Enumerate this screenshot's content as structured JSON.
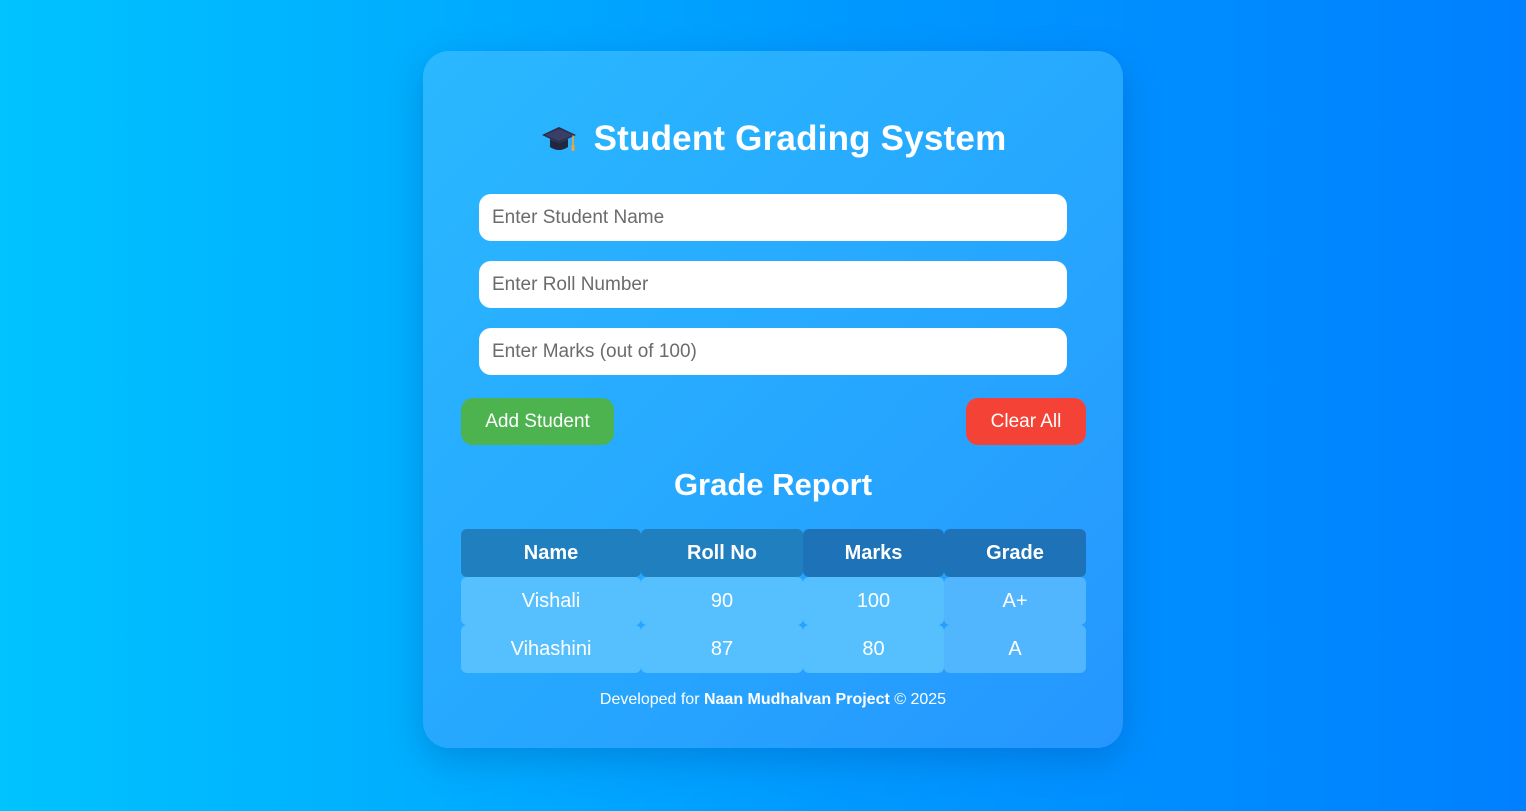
{
  "header": {
    "icon": "graduation-cap-icon",
    "title": "Student Grading System"
  },
  "form": {
    "name_placeholder": "Enter Student Name",
    "roll_placeholder": "Enter Roll Number",
    "marks_placeholder": "Enter Marks (out of 100)",
    "name_value": "",
    "roll_value": "",
    "marks_value": ""
  },
  "buttons": {
    "add_label": "Add Student",
    "clear_label": "Clear All"
  },
  "report": {
    "title": "Grade Report",
    "columns": [
      "Name",
      "Roll No",
      "Marks",
      "Grade"
    ],
    "rows": [
      [
        "Vishali",
        "90",
        "100",
        "A+"
      ],
      [
        "Vihashini",
        "87",
        "80",
        "A"
      ]
    ]
  },
  "footer": {
    "prefix": "Developed for ",
    "project": "Naan Mudhalvan Project",
    "suffix": " © 2025"
  },
  "colors": {
    "add_button": "#4cb34f",
    "clear_button": "#f44336",
    "table_header": "#1f7fbf",
    "table_cell": "#56c0ff"
  }
}
